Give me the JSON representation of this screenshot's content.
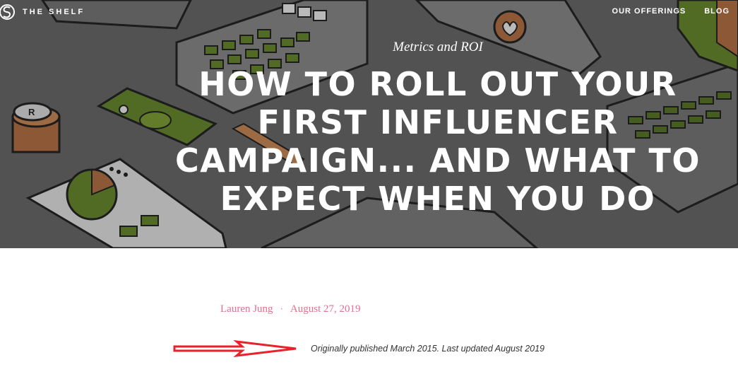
{
  "header": {
    "brand": "THE SHELF",
    "nav": [
      "OUR OFFERINGS",
      "BLOG"
    ]
  },
  "hero": {
    "category": "Metrics and ROI",
    "headline": "HOW TO ROLL OUT YOUR FIRST INFLUENCER CAMPAIGN... AND WHAT TO EXPECT WHEN YOU DO"
  },
  "article": {
    "author": "Lauren Jung",
    "separator": "·",
    "date": "August 27, 2019",
    "note": "Originally published March 2015. Last updated August 2019"
  },
  "colors": {
    "accent_pink": "#e66f8e",
    "annotation_red": "#e8212a",
    "hero_gray": "#5b5b5b",
    "illustration_green": "#4f6a1e"
  }
}
